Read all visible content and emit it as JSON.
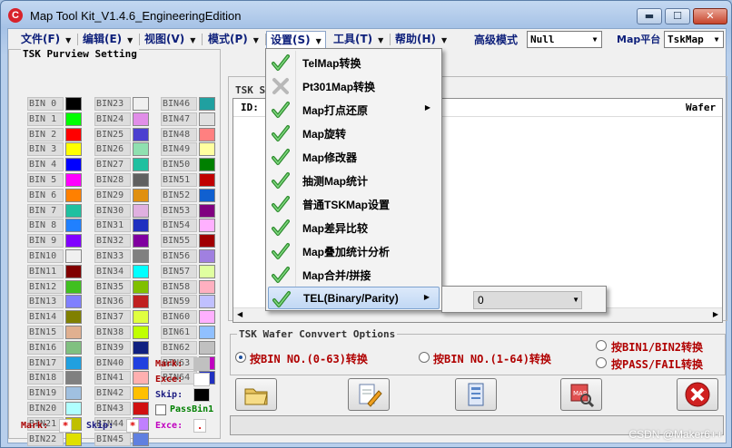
{
  "window": {
    "title": "Map Tool Kit_V1.4.6_EngineeringEdition",
    "min_glyph": "▬",
    "max_glyph": "☐",
    "close_glyph": "✕"
  },
  "menubar": {
    "items": [
      {
        "label": "文件(F)"
      },
      {
        "label": "编辑(E)"
      },
      {
        "label": "视图(V)"
      },
      {
        "label": "模式(P)"
      },
      {
        "label": "设置(S)"
      },
      {
        "label": "工具(T)"
      },
      {
        "label": "帮助(H)"
      }
    ],
    "advanced_mode_label": "高级模式",
    "advanced_mode_value": "Null",
    "map_platform_label": "Map平台",
    "map_platform_value": "TskMap"
  },
  "purview": {
    "title": "TSK Purview Setting",
    "bins": [
      {
        "label": "BIN 0",
        "color": "#000000"
      },
      {
        "label": "BIN23",
        "color": "#f0f0f0"
      },
      {
        "label": "BIN46",
        "color": "#20a0a0"
      },
      {
        "label": "BIN 1",
        "color": "#00ff00"
      },
      {
        "label": "BIN24",
        "color": "#e18ee8"
      },
      {
        "label": "BIN47",
        "color": "#e0e0e0"
      },
      {
        "label": "BIN 2",
        "color": "#ff0000"
      },
      {
        "label": "BIN25",
        "color": "#4b3fd0"
      },
      {
        "label": "BIN48",
        "color": "#ff8080"
      },
      {
        "label": "BIN 3",
        "color": "#ffff00"
      },
      {
        "label": "BIN26",
        "color": "#8fe0b0"
      },
      {
        "label": "BIN49",
        "color": "#ffffa0"
      },
      {
        "label": "BIN 4",
        "color": "#0000ff"
      },
      {
        "label": "BIN27",
        "color": "#20c0a0"
      },
      {
        "label": "BIN50",
        "color": "#008000"
      },
      {
        "label": "BIN 5",
        "color": "#ff00ff"
      },
      {
        "label": "BIN28",
        "color": "#606060"
      },
      {
        "label": "BIN51",
        "color": "#c00000"
      },
      {
        "label": "BIN 6",
        "color": "#ff8000"
      },
      {
        "label": "BIN29",
        "color": "#e09010"
      },
      {
        "label": "BIN52",
        "color": "#1060d0"
      },
      {
        "label": "BIN 7",
        "color": "#20c0a0"
      },
      {
        "label": "BIN30",
        "color": "#e0b0e0"
      },
      {
        "label": "BIN53",
        "color": "#800080"
      },
      {
        "label": "BIN 8",
        "color": "#2080ff"
      },
      {
        "label": "BIN31",
        "color": "#2030c0"
      },
      {
        "label": "BIN54",
        "color": "#ffb0ff"
      },
      {
        "label": "BIN 9",
        "color": "#8000ff"
      },
      {
        "label": "BIN32",
        "color": "#8000a0"
      },
      {
        "label": "BIN55",
        "color": "#a00000"
      },
      {
        "label": "BIN10",
        "color": "#f0f0f0"
      },
      {
        "label": "BIN33",
        "color": "#808080"
      },
      {
        "label": "BIN56",
        "color": "#a080e0"
      },
      {
        "label": "BIN11",
        "color": "#800000"
      },
      {
        "label": "BIN34",
        "color": "#00ffff"
      },
      {
        "label": "BIN57",
        "color": "#e0ffa0"
      },
      {
        "label": "BIN12",
        "color": "#40c020"
      },
      {
        "label": "BIN35",
        "color": "#80c000"
      },
      {
        "label": "BIN58",
        "color": "#ffb0c0"
      },
      {
        "label": "BIN13",
        "color": "#8080ff"
      },
      {
        "label": "BIN36",
        "color": "#c02020"
      },
      {
        "label": "BIN59",
        "color": "#c0c0ff"
      },
      {
        "label": "BIN14",
        "color": "#808000"
      },
      {
        "label": "BIN37",
        "color": "#e0ff40"
      },
      {
        "label": "BIN60",
        "color": "#ffb0ff"
      },
      {
        "label": "BIN15",
        "color": "#e0b090"
      },
      {
        "label": "BIN38",
        "color": "#c0ff00"
      },
      {
        "label": "BIN61",
        "color": "#90c0ff"
      },
      {
        "label": "BIN16",
        "color": "#80c080"
      },
      {
        "label": "BIN39",
        "color": "#102080"
      },
      {
        "label": "BIN62",
        "color": "#c0c0c0"
      },
      {
        "label": "BIN17",
        "color": "#20a0e0"
      },
      {
        "label": "BIN40",
        "color": "#2040e0"
      },
      {
        "label": "BIN63",
        "color": "#c000c0"
      },
      {
        "label": "BIN18",
        "color": "#808080"
      },
      {
        "label": "BIN41",
        "color": "#ffb0b0"
      },
      {
        "label": "BIN64",
        "color": "#2030c0"
      }
    ],
    "extra_bins": [
      {
        "label": "BIN19",
        "color": "#a0c0e0"
      },
      {
        "label": "BIN42",
        "color": "#ffc000"
      },
      {
        "label": "BIN20",
        "color": "#b0ffff"
      },
      {
        "label": "BIN43",
        "color": "#d01010"
      },
      {
        "label": "BIN21",
        "color": "#c0c000"
      },
      {
        "label": "BIN44",
        "color": "#c080ff"
      },
      {
        "label": "BIN22",
        "color": "#e0e000"
      },
      {
        "label": "BIN45",
        "color": "#6080e0"
      }
    ],
    "mark_label": "Mark:",
    "mark_color": "#c0c0c0",
    "exce_label": "Exce:",
    "exce_color": "#ffffff",
    "skip_label": "Skip:",
    "skip_color": "#000000",
    "passbin_label": "PassBin1",
    "bottom_mark_label": "Mark:",
    "bottom_mark_value": "*",
    "bottom_skip_label": "Skip:",
    "bottom_skip_value": "*",
    "bottom_exce_label": "Exce:",
    "bottom_exce_value": "."
  },
  "wafer": {
    "group_title": "TSK S",
    "col_id": "ID:",
    "col_wafer": "Wafer"
  },
  "convert": {
    "title": "TSK Wafer Convvert Options",
    "options": [
      {
        "label": "按BIN NO.(0-63)转换",
        "selected": true
      },
      {
        "label": "按BIN NO.(1-64)转换",
        "selected": false
      },
      {
        "label": "按BIN1/BIN2转换",
        "selected": false
      },
      {
        "label": "按PASS/FAIL转换",
        "selected": false
      }
    ]
  },
  "toolbar": {
    "icons": [
      "folder-icon",
      "edit-document-icon",
      "report-icon",
      "map-search-icon",
      "exit-icon"
    ]
  },
  "settings_menu": {
    "items": [
      {
        "label": "TelMap转换",
        "icon": "check-icon",
        "submenu": false
      },
      {
        "label": "Pt301Map转换",
        "icon": "disabled-x-icon",
        "submenu": false
      },
      {
        "label": "Map打点还原",
        "icon": "check-icon",
        "submenu": true
      },
      {
        "label": "Map旋转",
        "icon": "check-icon",
        "submenu": false
      },
      {
        "label": "Map修改器",
        "icon": "check-icon",
        "submenu": false
      },
      {
        "label": "抽测Map统计",
        "icon": "check-icon",
        "submenu": false
      },
      {
        "label": "普通TSKMap设置",
        "icon": "check-icon",
        "submenu": false
      },
      {
        "label": "Map差异比较",
        "icon": "check-icon",
        "submenu": false
      },
      {
        "label": "Map叠加统计分析",
        "icon": "check-icon",
        "submenu": false
      },
      {
        "label": "Map合并/拼接",
        "icon": "check-icon",
        "submenu": false
      },
      {
        "label": "TEL(Binary/Parity)",
        "icon": "check-icon",
        "submenu": true,
        "highlighted": true
      }
    ],
    "submenu_value": "0"
  },
  "watermark": "CSDN @Maker6++"
}
